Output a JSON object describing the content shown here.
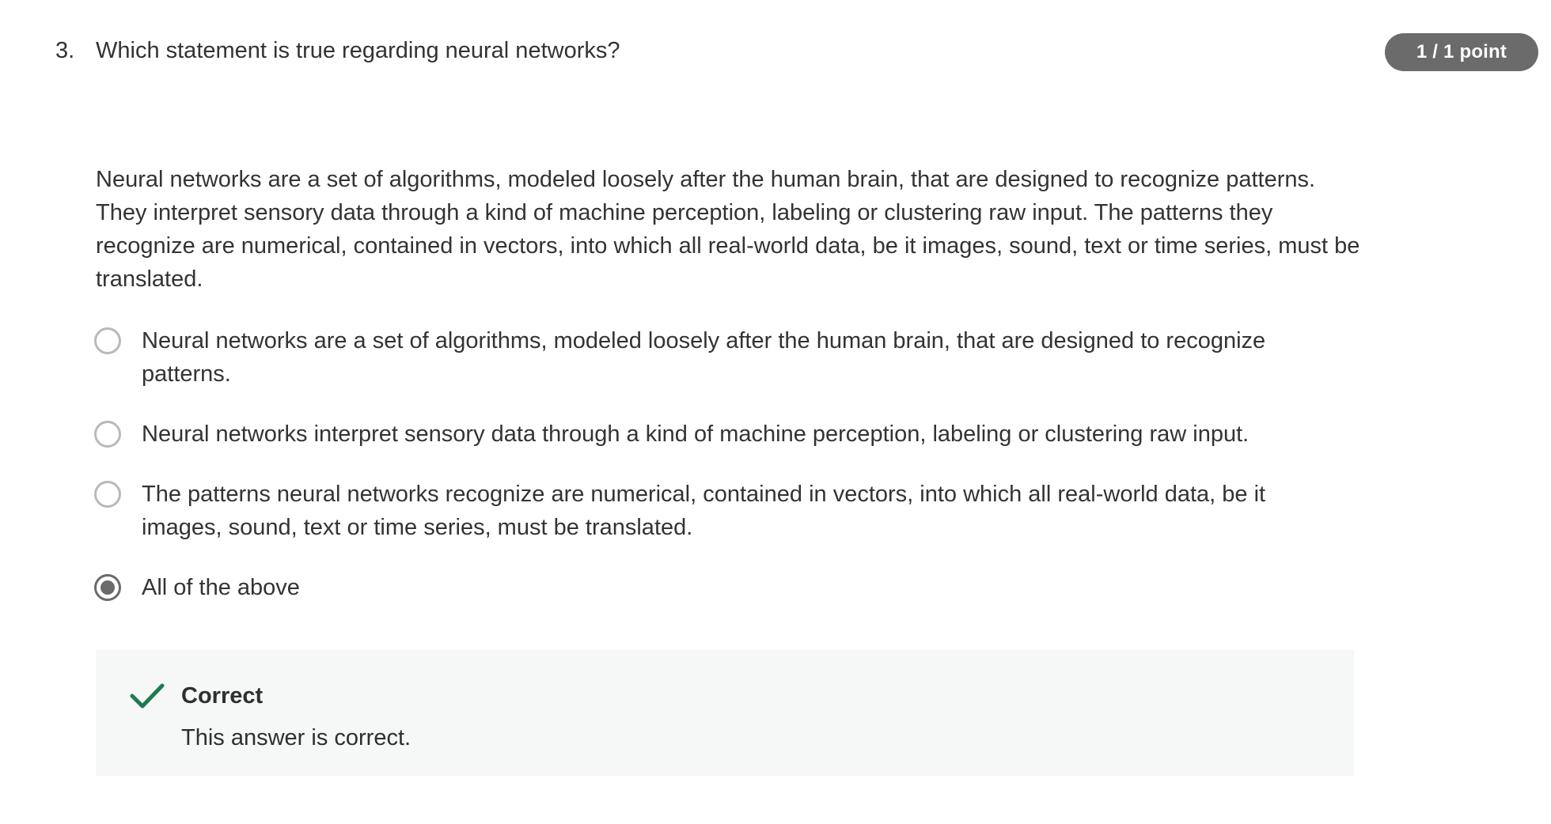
{
  "question": {
    "number": "3.",
    "title": "Which statement is true regarding neural networks?",
    "points": "1 / 1 point",
    "description": "Neural networks are a set of algorithms, modeled loosely after the human brain, that are designed to recognize patterns. They interpret sensory data through a kind of machine perception, labeling or clustering raw input. The patterns they recognize are numerical, contained in vectors, into which all real-world data, be it images, sound, text or time series, must be translated."
  },
  "options": [
    {
      "label": "Neural networks are a set of algorithms, modeled loosely after the human brain, that are designed to recognize patterns.",
      "selected": false
    },
    {
      "label": "Neural networks interpret sensory data through a kind of machine perception, labeling or clustering raw input.",
      "selected": false
    },
    {
      "label": "The patterns neural networks recognize are numerical, contained in vectors, into which all real-world data, be it images, sound, text or time series, must be translated.",
      "selected": false
    },
    {
      "label": "All of the above",
      "selected": true
    }
  ],
  "feedback": {
    "icon": "check-icon",
    "title": "Correct",
    "text": "This answer is correct.",
    "accent_color": "#1f7a4f",
    "background_color": "#f5f8f7"
  },
  "colors": {
    "badge": "#6b6b6b",
    "text": "#333333",
    "radio_border": "#b9b9b9",
    "radio_selected": "#6b6b6b"
  }
}
